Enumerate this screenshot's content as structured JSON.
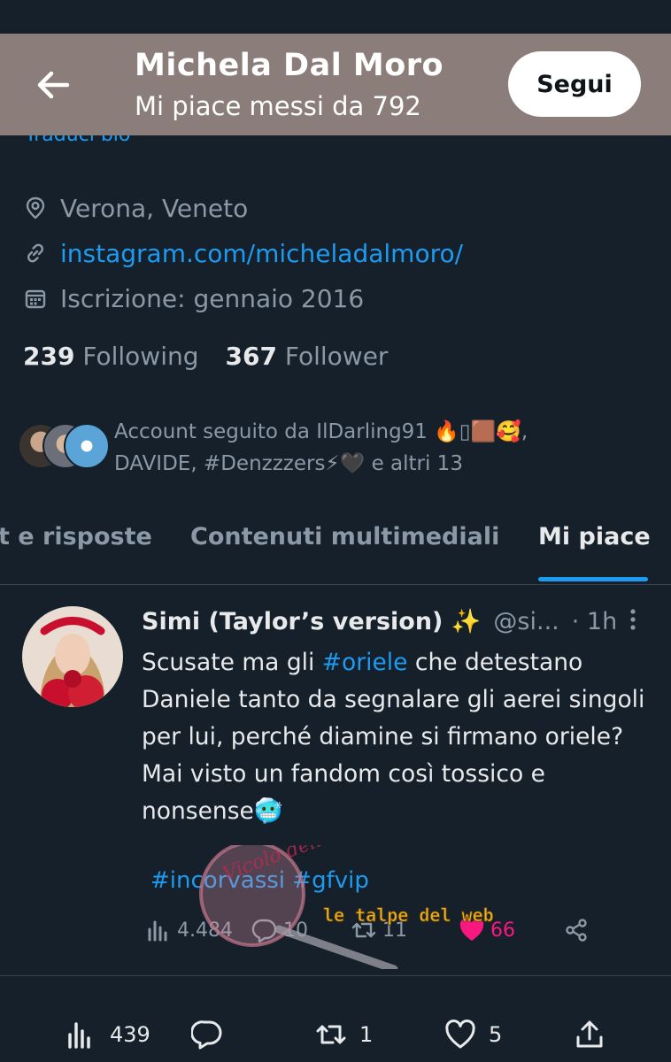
{
  "header": {
    "title": "Michela Dal Moro",
    "subtitle": "Mi piace messi da 792",
    "follow_label": "Segui",
    "bg_color": "#8b7d7a"
  },
  "profile": {
    "translate_bio": "Traduci bio",
    "location": "Verona, Veneto",
    "website": "instagram.com/micheladalmoro/",
    "joined": "Iscrizione: gennaio 2016",
    "following_count": "239",
    "following_label": "Following",
    "followers_count": "367",
    "followers_label": "Follower",
    "followed_by_line1": "Account seguito da IlDarling91 🔥▯🟫🥰,",
    "followed_by_line2": "DAVIDE, #Denzzzers⚡🖤 e altri 13"
  },
  "tabs": [
    {
      "label": "t e risposte",
      "active": false
    },
    {
      "label": "Contenuti multimediali",
      "active": false
    },
    {
      "label": "Mi piace",
      "active": true
    }
  ],
  "tweet": {
    "name": "Simi (Taylor’s version) ✨",
    "handle": "@si...",
    "time": "· 1h",
    "text_before": "Scusate ma gli ",
    "hashtag": "#oriele",
    "text_after": " che detestano Daniele tanto da segnalare gli aerei singoli per lui, perché diamine si firmano oriele? Mai visto un fandom così tossico e nonsense🥶",
    "tags": "#incorvassi #gfvip",
    "views": "4.484",
    "replies": "10",
    "retweets": "11",
    "likes": "66"
  },
  "bottom_bar": {
    "views": "439",
    "retweets": "1",
    "likes": "5"
  },
  "watermark": {
    "text1": "Vicolo delle News",
    "text2": "le talpe del web"
  },
  "colors": {
    "background": "#15202b",
    "accent": "#1d9bf0",
    "like": "#f91880"
  }
}
